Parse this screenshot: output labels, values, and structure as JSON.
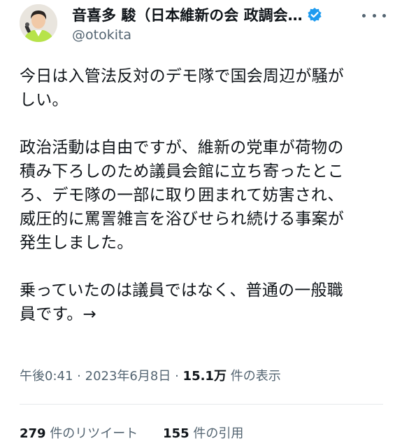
{
  "author": {
    "display_name": "音喜多 駿（日本維新の会 政調会…",
    "handle": "@otokita",
    "verified_color": "#1d9bf0",
    "avatar_icon": "person-with-microphone"
  },
  "tweet": {
    "paragraphs": [
      [
        "今日は入管法反対のデモ隊で国会周辺が騒が",
        "しい。"
      ],
      [
        "政治活動は自由ですが、維新の党車が荷物の",
        "積み下ろしのため議員会館に立ち寄ったとこ",
        "ろ、デモ隊の一部に取り囲まれて妨害され、",
        "威圧的に罵詈雑言を浴びせられ続ける事案が",
        "発生しました。"
      ],
      [
        "乗っていたのは議員ではなく、普通の一般職",
        "員です。→"
      ]
    ]
  },
  "meta": {
    "time": "午後0:41",
    "sep1": "·",
    "date": "2023年6月8日",
    "sep2": "·",
    "views_count": "15.1万",
    "views_label": "件の表示"
  },
  "stats": {
    "retweets_count": "279",
    "retweets_label": "件のリツイート",
    "quotes_count": "155",
    "quotes_label": "件の引用"
  }
}
